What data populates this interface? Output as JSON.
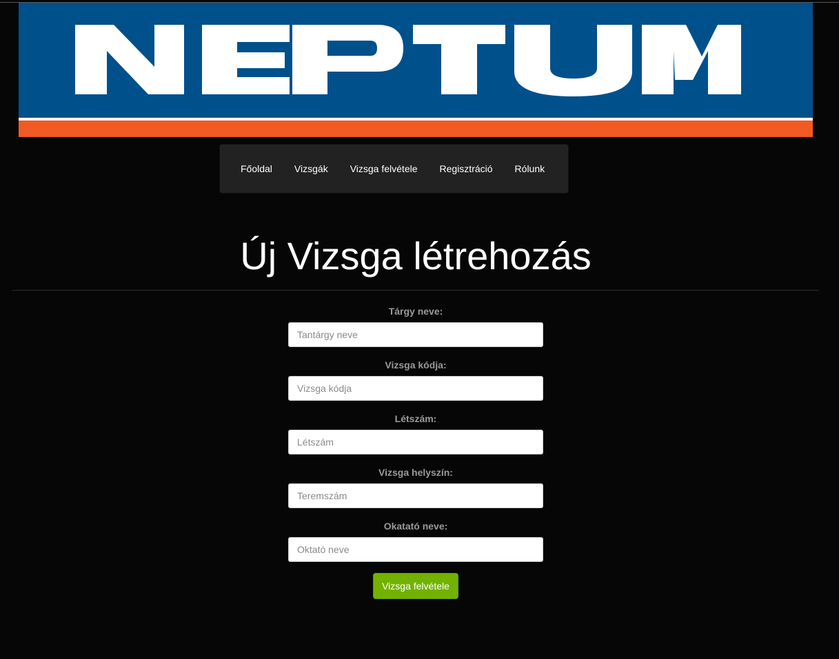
{
  "banner": {
    "logo_text": "NEPTUM",
    "colors": {
      "blue": "#00508c",
      "white": "#ffffff",
      "orange": "#f15a22"
    }
  },
  "nav": {
    "items": [
      {
        "label": "Főoldal"
      },
      {
        "label": "Vizsgák"
      },
      {
        "label": "Vizsga felvétele"
      },
      {
        "label": "Regisztráció"
      },
      {
        "label": "Rólunk"
      }
    ]
  },
  "page": {
    "title": "Új Vizsga létrehozás"
  },
  "form": {
    "fields": [
      {
        "label": "Tárgy neve:",
        "placeholder": "Tantárgy neve",
        "value": ""
      },
      {
        "label": "Vizsga kódja:",
        "placeholder": "Vizsga kódja",
        "value": ""
      },
      {
        "label": "Létszám:",
        "placeholder": "Létszám",
        "value": ""
      },
      {
        "label": "Vizsga helyszín:",
        "placeholder": "Teremszám",
        "value": ""
      },
      {
        "label": "Okatató neve:",
        "placeholder": "Oktató neve",
        "value": ""
      }
    ],
    "submit_label": "Vizsga felvétele",
    "submit_color": "#73b200"
  }
}
